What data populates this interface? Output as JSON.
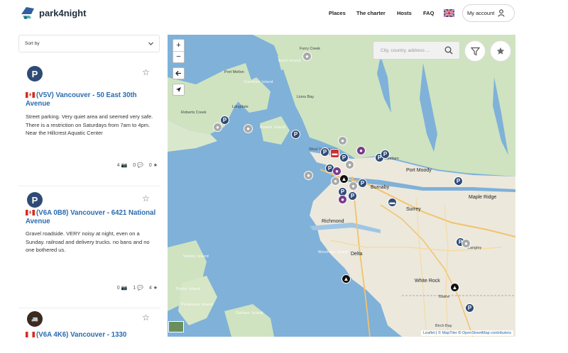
{
  "header": {
    "logo_text": "park4night",
    "nav": [
      "Places",
      "The charter",
      "Hosts",
      "FAQ"
    ],
    "account_label": "My account"
  },
  "list": {
    "sort_label": "Sort by",
    "cards": [
      {
        "title": "(V5V) Vancouver - 50 East 30th Avenue",
        "description": "Street parking. Very quiet area and seemed very safe. There is a restriction on Saturdays from 7am to 4pm. Near the Hillcrest Aquatic Center",
        "photos": "4",
        "comments": "0",
        "rating": "0"
      },
      {
        "title": "(V6A 0B8) Vancouver - 6421 National Avenue",
        "description": "Gravel roadside. VERY noisy at night, even on a Sunday. railroad and delivery trucks. no bans and no one bothered us.",
        "photos": "0",
        "comments": "1",
        "rating": "4"
      },
      {
        "title": "(V6A 4K6) Vancouver - 1330",
        "description": "",
        "photos": "",
        "comments": "",
        "rating": ""
      }
    ]
  },
  "map": {
    "search_placeholder": "City, country, address ...",
    "places": [
      "Furry Creek",
      "Port Mellon",
      "Gambier Island",
      "Anvil Island",
      "Lions Bay",
      "Roberts Creek",
      "Langdale",
      "Bowen Island",
      "West Vancouver",
      "Burnaby",
      "Port Moody",
      "Coquitlam",
      "Maple Ridge",
      "Surrey",
      "Richmond",
      "Delta",
      "Langley",
      "White Rock",
      "Blaine",
      "Birch Bay",
      "Valdes Island",
      "Thetis Island",
      "Penelakut Island",
      "Galiano Island",
      "Westham Island"
    ],
    "road_badges": [
      "99",
      "91",
      "99",
      "17",
      "15",
      "1"
    ],
    "attribution": {
      "leaflet": "Leaflet",
      "sep1": "|",
      "maptiler": "© MapTiler",
      "sep2": "©",
      "osm": "OpenStreetMap contributors"
    }
  }
}
